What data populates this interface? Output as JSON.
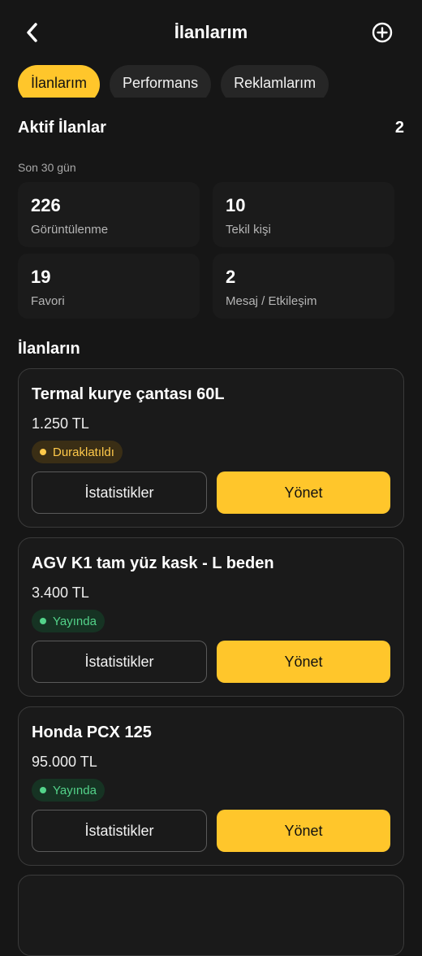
{
  "header": {
    "title": "İlanlarım",
    "back_icon": "chevron-left-icon",
    "add_icon": "plus-circle-icon"
  },
  "tabs": [
    {
      "label": "İlanlarım",
      "active": true
    },
    {
      "label": "Performans",
      "active": false
    },
    {
      "label": "Reklamlarım",
      "active": false
    }
  ],
  "summary": {
    "title": "Aktif İlanlar",
    "count": "2",
    "period": "Son 30 gün",
    "stats": [
      {
        "value": "226",
        "label": "Görüntülenme"
      },
      {
        "value": "10",
        "label": "Tekil kişi"
      },
      {
        "value": "19",
        "label": "Favori"
      },
      {
        "value": "2",
        "label": "Mesaj / Etkileşim"
      }
    ]
  },
  "listings_title": "İlanların",
  "listings": [
    {
      "name": "Termal kurye çantası 60L",
      "price": "1.250 TL",
      "status": "Duraklatıldı",
      "status_type": "paused",
      "stats_button": "İstatistikler",
      "manage_button": "Yönet"
    },
    {
      "name": "AGV K1 tam yüz kask - L beden",
      "price": "3.400 TL",
      "status": "Yayında",
      "status_type": "live",
      "stats_button": "İstatistikler",
      "manage_button": "Yönet"
    },
    {
      "name": "Honda PCX 125",
      "price": "95.000 TL",
      "status": "Yayında",
      "status_type": "live",
      "stats_button": "İstatistikler",
      "manage_button": "Yönet"
    }
  ],
  "colors": {
    "accent": "#ffc62b",
    "background": "#161616",
    "paused": "#ffc94a",
    "live": "#53d38a"
  }
}
